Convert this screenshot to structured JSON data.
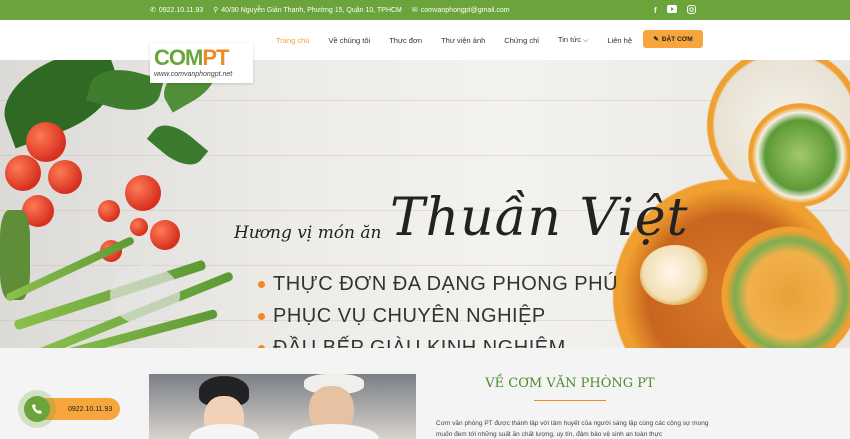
{
  "topbar": {
    "phone": "0922.10.11.93",
    "address": "40/30 Nguyễn Giản Thanh, Phường 15, Quận 10, TPHCM",
    "email": "comvanphongpt@gmail.com",
    "social": [
      "facebook-icon",
      "youtube-icon",
      "instagram-icon"
    ]
  },
  "logo": {
    "brand_c": "C",
    "brand_o": "OM",
    "brand_pt": "PT",
    "url": "www.comvanphongpt.net"
  },
  "nav": {
    "items": [
      "Trang chủ",
      "Về chúng tôi",
      "Thực đơn",
      "Thư viện ảnh",
      "Chứng chỉ",
      "Tin tức",
      "Liên hệ"
    ],
    "order_label": "ĐẶT CƠM"
  },
  "banner": {
    "script_line": "Hương vị món ăn",
    "big_line": "Thuần Việt",
    "bullets": [
      "THỰC ĐƠN ĐA DẠNG PHONG PHÚ",
      "PHỤC VỤ CHUYÊN NGHIỆP",
      "ĐẦU BẾP GIÀU KINH NGHIỆM"
    ]
  },
  "about": {
    "title": "VỀ CƠM VĂN PHÒNG PT",
    "text": "Cơm văn phòng PT được thành lập với tâm huyết của người sáng lập cùng các cộng sự mong muốn đem tới những suất ăn chất lượng, uy tín, đảm bảo vệ sinh an toàn thực"
  },
  "floating_phone": {
    "number": "0922.10.11.93"
  },
  "colors": {
    "brand_green": "#6aa43a",
    "accent_orange": "#f6a63c"
  }
}
